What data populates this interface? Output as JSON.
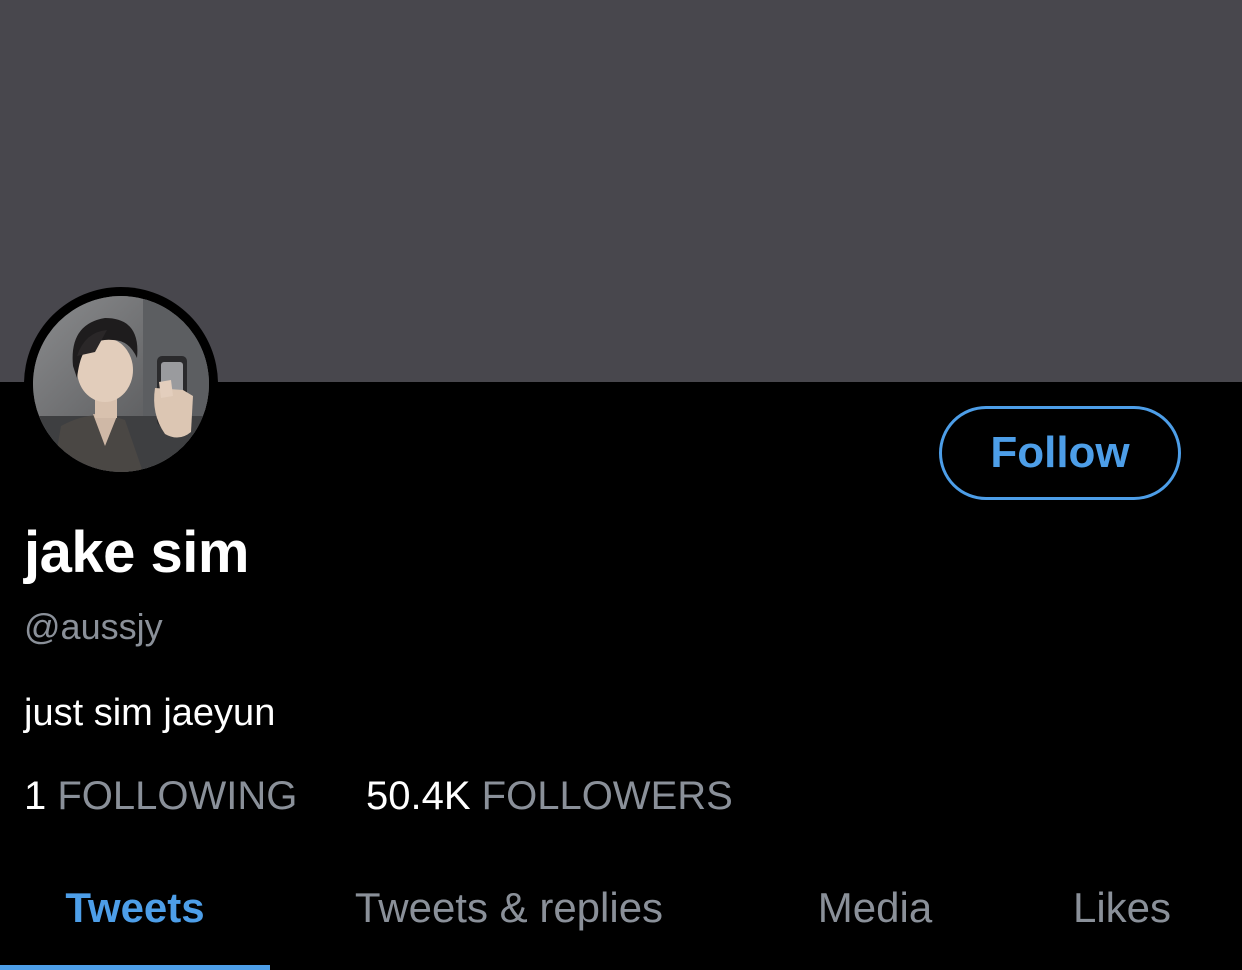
{
  "profile": {
    "name": "jake sim",
    "handle": "@aussjy",
    "bio": "just sim jaeyun",
    "follow_button_label": "Follow",
    "following_count": "1",
    "following_label": "FOLLOWING",
    "followers_count": "50.4K",
    "followers_label": "FOLLOWERS",
    "avatar": "profile-photo"
  },
  "tabs": [
    {
      "label": "Tweets",
      "active": true
    },
    {
      "label": "Tweets & replies",
      "active": false
    },
    {
      "label": "Media",
      "active": false
    },
    {
      "label": "Likes",
      "active": false
    }
  ],
  "colors": {
    "accent": "#4d9ee8",
    "banner": "#48474d",
    "background": "#000000",
    "secondary_text": "#8a9099"
  }
}
